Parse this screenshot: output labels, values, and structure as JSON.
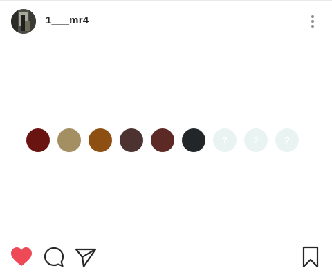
{
  "post": {
    "username": "1___mr4"
  },
  "header": {
    "avatar_icon": "profile-photo",
    "menu_icon": "more-vertical-icon"
  },
  "palette": {
    "swatches": [
      {
        "color": "#6a1412",
        "label": ""
      },
      {
        "color": "#a48f63",
        "label": ""
      },
      {
        "color": "#8e5012",
        "label": ""
      },
      {
        "color": "#4c3331",
        "label": ""
      },
      {
        "color": "#5c2924",
        "label": ""
      },
      {
        "color": "#232629",
        "label": ""
      },
      {
        "color": "#e8f3f2",
        "label": "?"
      },
      {
        "color": "#e8f3f2",
        "label": "?"
      },
      {
        "color": "#e8f3f2",
        "label": "?"
      }
    ]
  },
  "actions": {
    "like_icon": "heart-filled-icon",
    "comment_icon": "comment-icon",
    "share_icon": "send-icon",
    "save_icon": "bookmark-icon",
    "like_color": "#ed4956",
    "icon_color": "#262626"
  }
}
